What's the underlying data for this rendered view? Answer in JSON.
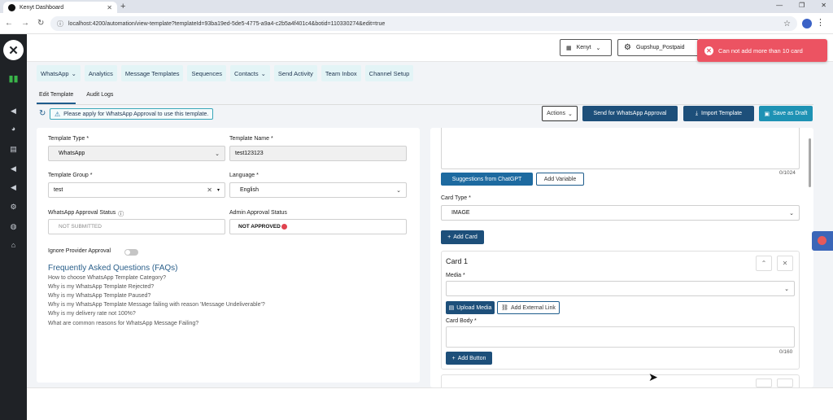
{
  "browser": {
    "tab_title": "Kenyt Dashboard",
    "url": "localhost:4200/automation/view-template?templateId=93ba19ed-5de5-4775-a9a4-c2b5a4f401c4&botid=110330274&edit=true"
  },
  "header": {
    "account": "Kenyt",
    "provider": "Gupshup_Postpaid"
  },
  "toast": {
    "message": "Can not add more than 10 card"
  },
  "menu": [
    {
      "label": "WhatsApp",
      "caret": true
    },
    {
      "label": "Analytics",
      "caret": false
    },
    {
      "label": "Message Templates",
      "caret": false
    },
    {
      "label": "Sequences",
      "caret": false
    },
    {
      "label": "Contacts",
      "caret": true
    },
    {
      "label": "Send Activity",
      "caret": false
    },
    {
      "label": "Team Inbox",
      "caret": false
    },
    {
      "label": "Channel Setup",
      "caret": false
    }
  ],
  "subtabs": {
    "edit": "Edit Template",
    "audit": "Audit Logs"
  },
  "notice": "Please apply for WhatsApp Approval to use this template.",
  "toolbar": {
    "actions": "Actions",
    "send_approval": "Send for WhatsApp Approval",
    "import": "Import Template",
    "save_draft": "Save as Draft"
  },
  "form": {
    "template_type_label": "Template Type *",
    "template_type_value": "WhatsApp",
    "template_name_label": "Template Name *",
    "template_name_value": "test123123",
    "template_group_label": "Template Group *",
    "template_group_value": "test",
    "language_label": "Language *",
    "language_value": "English",
    "wa_status_label": "WhatsApp Approval Status",
    "wa_status_value": "NOT SUBMITTED",
    "admin_status_label": "Admin Approval Status",
    "admin_status_value": "NOT APPROVED",
    "ignore_provider_label": "Ignore Provider Approval"
  },
  "faq": {
    "heading": "Frequently Asked Questions (FAQs)",
    "items": [
      "How to choose WhatsApp Template Category?",
      "Why is my WhatsApp Template Rejected?",
      "Why is my WhatsApp Template Paused?",
      "Why is my WhatsApp Template Message failing with reason 'Message Undeliverable'?",
      "Why is my delivery rate not 100%?",
      "What are common reasons for WhatsApp Message Failing?"
    ]
  },
  "right": {
    "body_counter": "0/1024",
    "suggest_btn": "Suggestions from ChatGPT",
    "add_variable_btn": "Add Variable",
    "card_type_label": "Card Type *",
    "card_type_value": "IMAGE",
    "add_card_btn": "Add Card",
    "card_title": "Card 1",
    "media_label": "Media *",
    "upload_media_btn": "Upload Media",
    "external_link_btn": "Add External Link",
    "card_body_label": "Card Body *",
    "card_body_counter": "0/160",
    "add_button_btn": "Add Button"
  }
}
